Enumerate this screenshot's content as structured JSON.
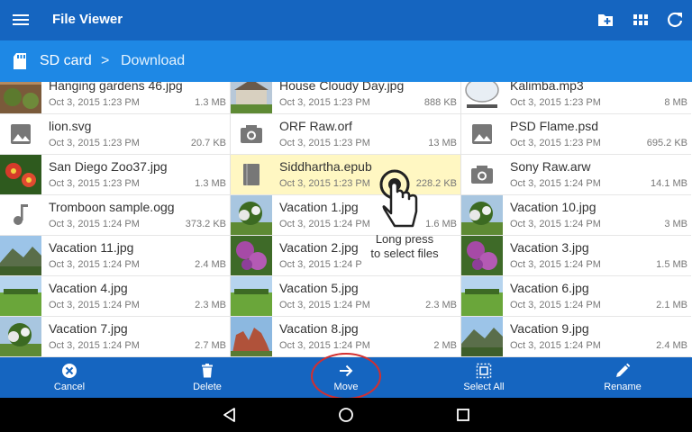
{
  "app": {
    "title": "File Viewer"
  },
  "toolbar": {
    "menu_icon": "hamburger-icon",
    "actions": [
      "new-folder-icon",
      "grid-view-icon",
      "refresh-icon"
    ]
  },
  "breadcrumb": {
    "root": "SD card",
    "separator": ">",
    "current": "Download"
  },
  "files": [
    [
      {
        "name": "Hanging gardens 46.jpg",
        "date": "Oct 3, 2015 1:23 PM",
        "size": "1.3 MB",
        "thumb": "photo-garden"
      },
      {
        "name": "lion.svg",
        "date": "Oct 3, 2015 1:23 PM",
        "size": "20.7 KB",
        "thumb": "image-icon"
      },
      {
        "name": "San Diego Zoo37.jpg",
        "date": "Oct 3, 2015 1:23 PM",
        "size": "1.3 MB",
        "thumb": "photo-flower"
      },
      {
        "name": "Tromboon sample.ogg",
        "date": "Oct 3, 2015 1:24 PM",
        "size": "373.2 KB",
        "thumb": "music-icon"
      },
      {
        "name": "Vacation 11.jpg",
        "date": "Oct 3, 2015 1:24 PM",
        "size": "2.4 MB",
        "thumb": "photo-mountain"
      },
      {
        "name": "Vacation 4.jpg",
        "date": "Oct 3, 2015 1:24 PM",
        "size": "2.3 MB",
        "thumb": "photo-field"
      },
      {
        "name": "Vacation 7.jpg",
        "date": "Oct 3, 2015 1:24 PM",
        "size": "2.7 MB",
        "thumb": "photo-tree"
      }
    ],
    [
      {
        "name": "House Cloudy Day.jpg",
        "date": "Oct 3, 2015 1:23 PM",
        "size": "888 KB",
        "thumb": "photo-house"
      },
      {
        "name": "ORF Raw.orf",
        "date": "Oct 3, 2015 1:23 PM",
        "size": "13 MB",
        "thumb": "camera-icon"
      },
      {
        "name": "Siddhartha.epub",
        "date": "Oct 3, 2015 1:23 PM",
        "size": "228.2 KB",
        "thumb": "book-icon",
        "selected": true
      },
      {
        "name": "Vacation 1.jpg",
        "date": "Oct 3, 2015 1:24 PM",
        "size": "1.6 MB",
        "thumb": "photo-tree"
      },
      {
        "name": "Vacation 2.jpg",
        "date": "Oct 3, 2015 1:24 P",
        "size": "",
        "thumb": "photo-lilac"
      },
      {
        "name": "Vacation 5.jpg",
        "date": "Oct 3, 2015 1:24 PM",
        "size": "2.3 MB",
        "thumb": "photo-field"
      },
      {
        "name": "Vacation 8.jpg",
        "date": "Oct 3, 2015 1:24 PM",
        "size": "2 MB",
        "thumb": "photo-rock"
      }
    ],
    [
      {
        "name": "Kalimba.mp3",
        "date": "Oct 3, 2015 1:23 PM",
        "size": "8 MB",
        "thumb": "photo-album"
      },
      {
        "name": "PSD Flame.psd",
        "date": "Oct 3, 2015 1:23 PM",
        "size": "695.2 KB",
        "thumb": "image-icon"
      },
      {
        "name": "Sony Raw.arw",
        "date": "Oct 3, 2015 1:24 PM",
        "size": "14.1 MB",
        "thumb": "camera-icon"
      },
      {
        "name": "Vacation 10.jpg",
        "date": "Oct 3, 2015 1:24 PM",
        "size": "3 MB",
        "thumb": "photo-tree"
      },
      {
        "name": "Vacation 3.jpg",
        "date": "Oct 3, 2015 1:24 PM",
        "size": "1.5 MB",
        "thumb": "photo-lilac"
      },
      {
        "name": "Vacation 6.jpg",
        "date": "Oct 3, 2015 1:24 PM",
        "size": "2.1 MB",
        "thumb": "photo-field"
      },
      {
        "name": "Vacation 9.jpg",
        "date": "Oct 3, 2015 1:24 PM",
        "size": "2.4 MB",
        "thumb": "photo-mountain"
      }
    ]
  ],
  "hint": {
    "line1": "Long press",
    "line2": "to select files"
  },
  "actions": {
    "cancel": "Cancel",
    "delete": "Delete",
    "move": "Move",
    "select_all": "Select All",
    "rename": "Rename"
  },
  "colors": {
    "primary": "#1565C0",
    "breadcrumb_bar": "#1E88E5",
    "selected_row": "#FFF7C2",
    "highlight_ring": "#D32F2F"
  }
}
